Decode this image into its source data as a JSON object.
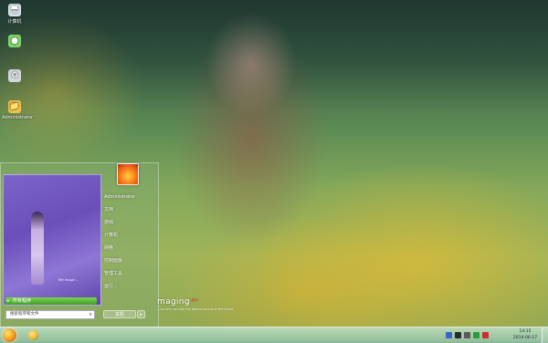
{
  "desktop": {
    "icons": [
      {
        "label": "计算机",
        "icon": "computer-icon",
        "color": "#d8e8f0"
      },
      {
        "label": "",
        "icon": "network-icon",
        "color": "#7ed36a"
      },
      {
        "label": "",
        "icon": "recycle-bin-icon",
        "color": "#cfd8dc"
      },
      {
        "label": "Administrator",
        "icon": "user-folder-icon",
        "color": "#f2c14e"
      }
    ]
  },
  "start_menu": {
    "username": "Administrator",
    "items": [
      "文档",
      "游戏",
      "计算机",
      "网络",
      "控制面板",
      "管理工具",
      "运行..."
    ],
    "all_programs": "所有程序",
    "search_placeholder": "搜索程序和文件",
    "shutdown": "关机",
    "preview_caption": "Ref Image ..."
  },
  "watermark": {
    "title": "maging",
    "badge": "pro",
    "subtitle": "...no one can see the digital record of the forest"
  },
  "taskbar": {
    "apps": [
      {
        "icon": "browser-icon",
        "color": "#f1b93a"
      }
    ],
    "tray_icons": [
      "flag-icon",
      "network-icon",
      "volume-icon",
      "security-icon",
      "ime-icon"
    ],
    "tray_colors": [
      "#3c64c8",
      "#2a2a2a",
      "#5a5a5a",
      "#2b9c3e",
      "#c83030"
    ],
    "time": "14:15",
    "date": "2014-06-17"
  },
  "colors": {
    "accent_green": "#3f9e2b",
    "panel_purple": "#6a4fb8"
  }
}
